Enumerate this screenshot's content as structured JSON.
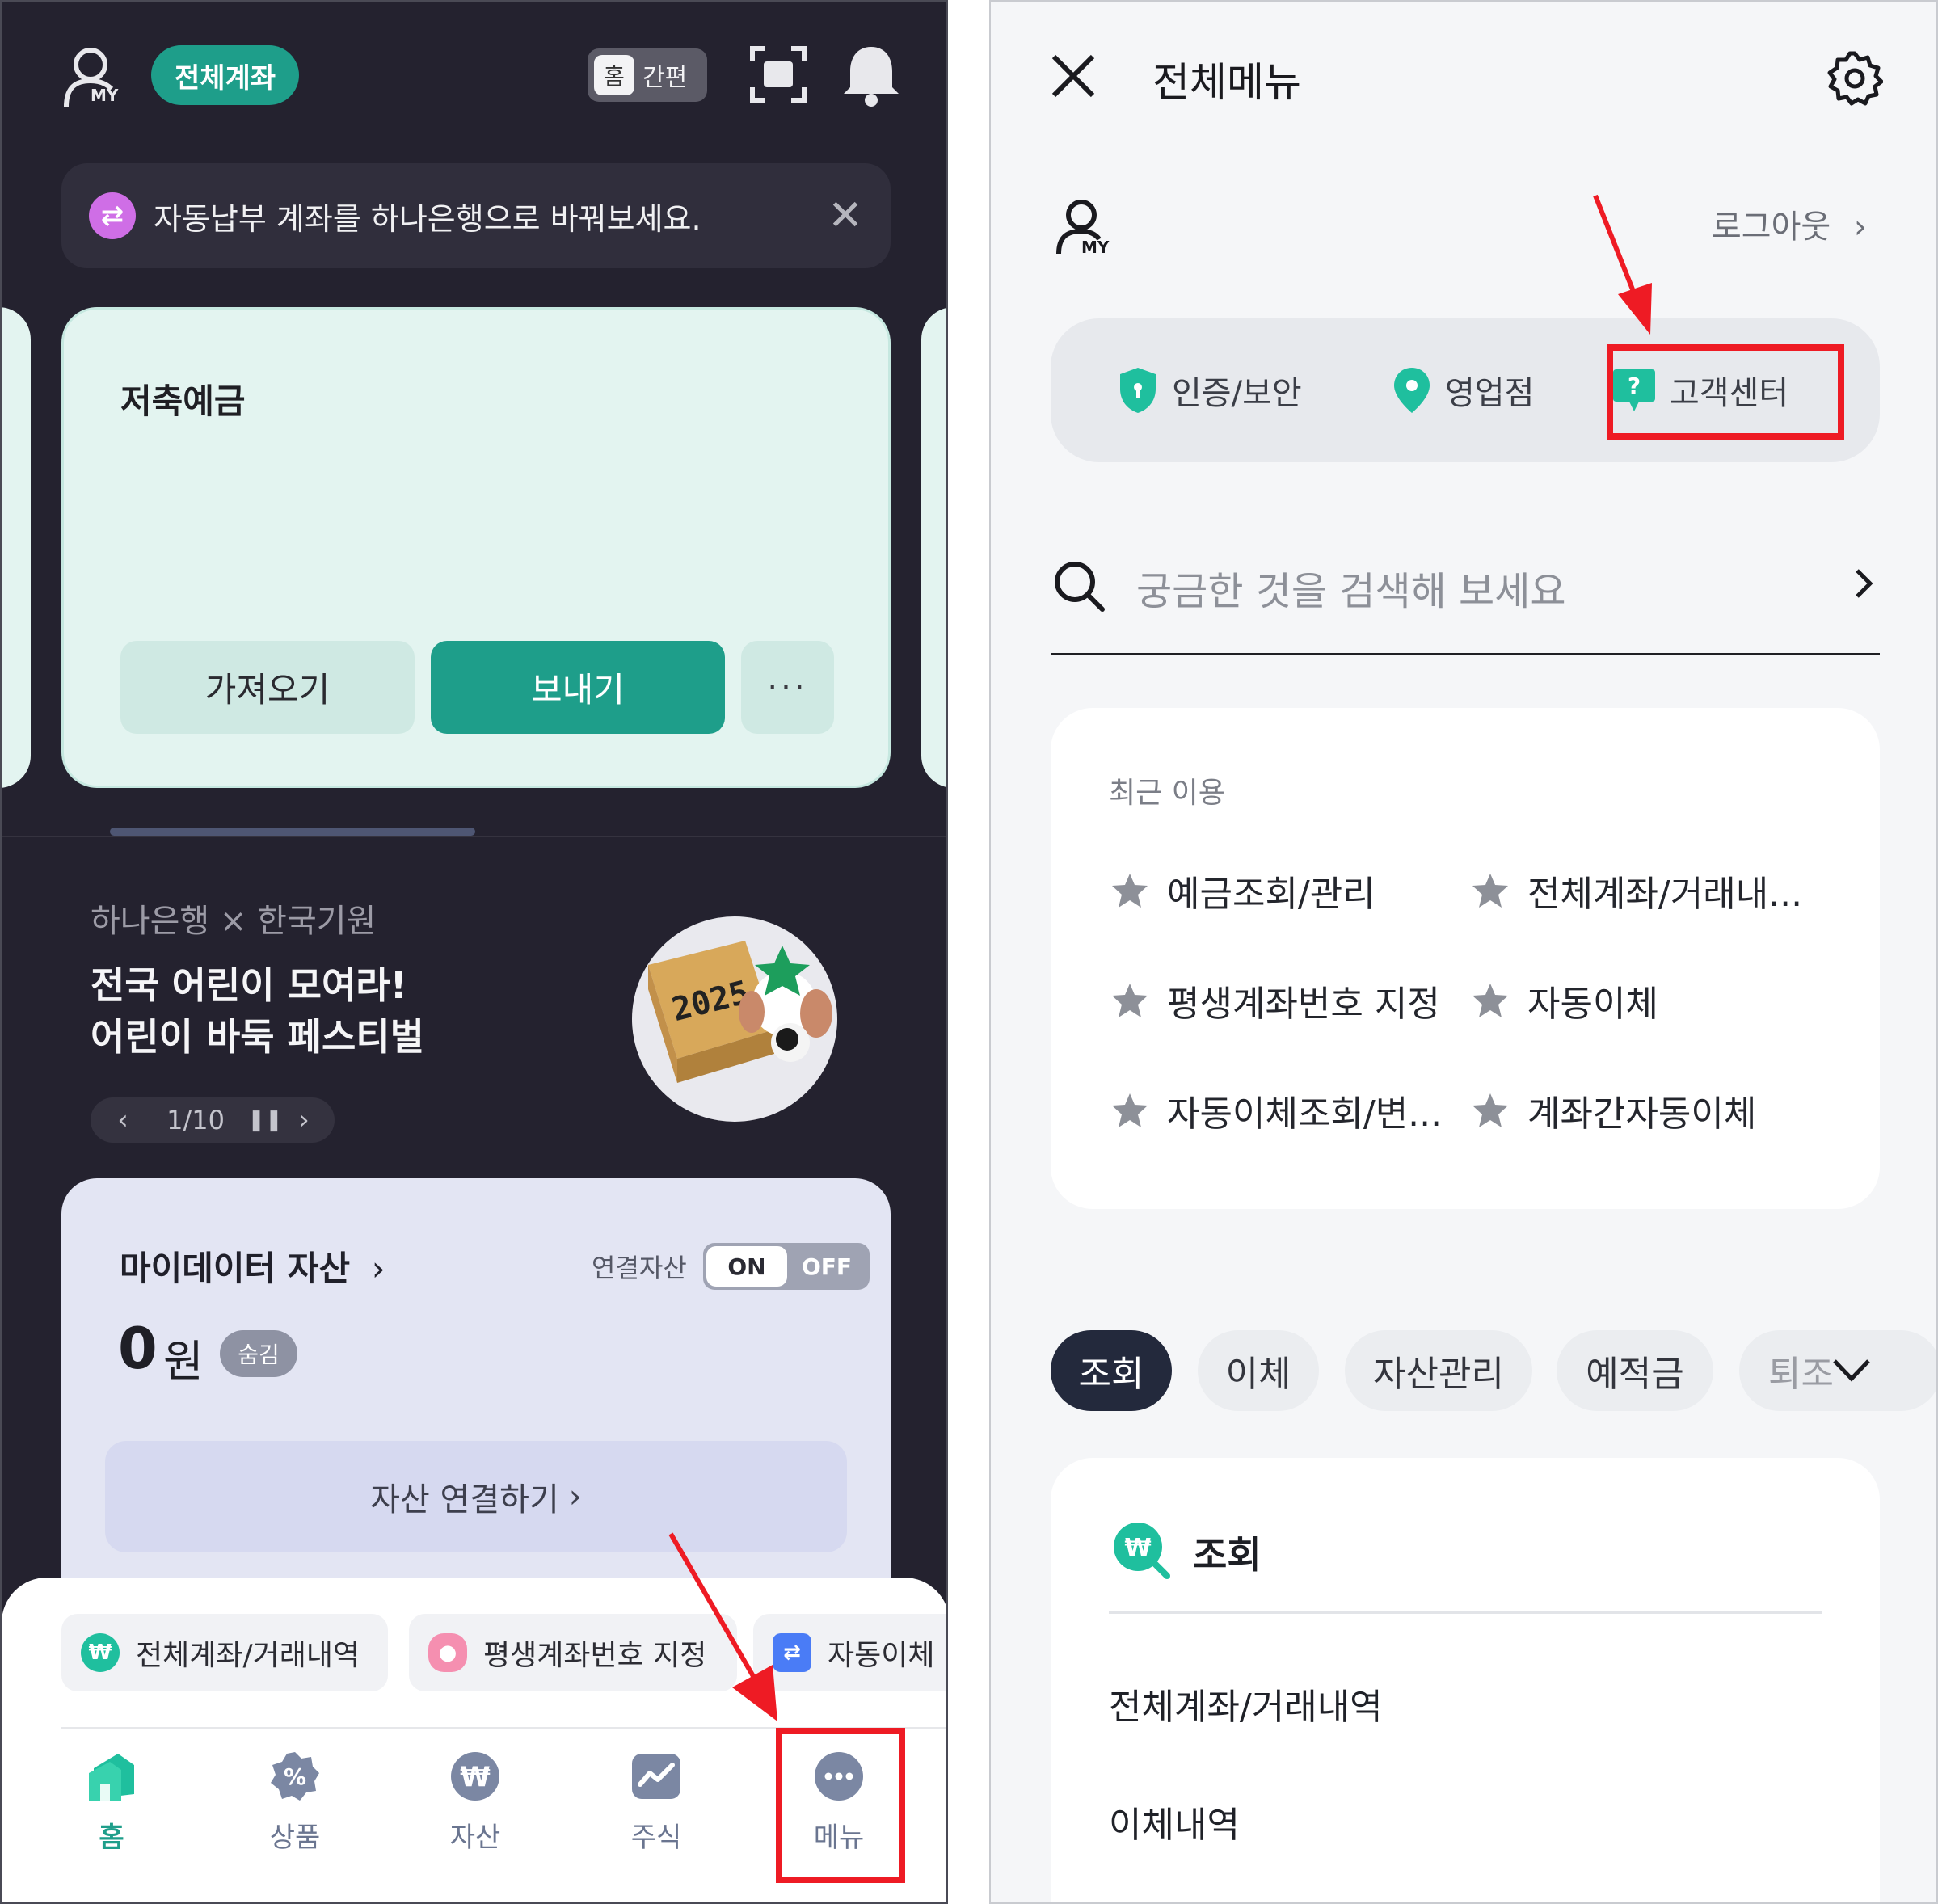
{
  "left": {
    "top_bar": {
      "my_label": "MY",
      "all_accounts_label": "전체계좌",
      "home_label": "홈",
      "simple_label": "간편"
    },
    "notice": {
      "text": "자동납부 계좌를 하나은행으로 바꿔보세요.",
      "icon": "swap-icon"
    },
    "savings_card": {
      "title": "저축예금",
      "get_button": "가져오기",
      "send_button": "보내기",
      "more_button": "···"
    },
    "promo": {
      "subtitle": "하나은행 × 한국기원",
      "title_line1": "전국 어린이 모여라!",
      "title_line2": "어린이 바둑 페스티벌",
      "pager": "1/10",
      "art_text": "2025"
    },
    "mydata": {
      "title": "마이데이터 자산",
      "linked_label": "연결자산",
      "toggle_on": "ON",
      "toggle_off": "OFF",
      "amount": "0",
      "unit": "원",
      "hide_label": "숨김",
      "connect_button": "자산 연결하기"
    },
    "quick_chips": [
      {
        "label": "전체계좌/거래내역",
        "icon": "won-search-icon",
        "color": "#1fbf9e"
      },
      {
        "label": "평생계좌번호 지정",
        "icon": "piggy-bank-icon",
        "color": "#f58fb0"
      },
      {
        "label": "자동이체",
        "icon": "transfer-icon",
        "color": "#4a7cf6"
      }
    ],
    "tabs": [
      {
        "label": "홈",
        "icon": "home-icon"
      },
      {
        "label": "상품",
        "icon": "product-percent-icon"
      },
      {
        "label": "자산",
        "icon": "won-icon"
      },
      {
        "label": "주식",
        "icon": "stock-chart-icon"
      },
      {
        "label": "메뉴",
        "icon": "more-dots-icon"
      }
    ],
    "colors": {
      "accent": "#1e9e8a",
      "background": "#24222f",
      "highlight": "#ee1b24"
    }
  },
  "right": {
    "title": "전체메뉴",
    "my_label": "MY",
    "logout": "로그아웃",
    "quick": [
      {
        "label": "인증/보안",
        "icon": "shield-icon"
      },
      {
        "label": "영업점",
        "icon": "location-pin-icon"
      },
      {
        "label": "고객센터",
        "icon": "help-chat-icon"
      }
    ],
    "search_placeholder": "궁금한 것을 검색해 보세요",
    "recent": {
      "title": "최근 이용",
      "items": [
        "예금조회/관리",
        "전체계좌/거래내...",
        "평생계좌번호 지정",
        "자동이체",
        "자동이체조회/변...",
        "계좌간자동이체"
      ]
    },
    "categories": [
      "조회",
      "이체",
      "자산관리",
      "예적금",
      "퇴조"
    ],
    "section": {
      "title": "조회",
      "items": [
        "전체계좌/거래내역",
        "이체내역"
      ]
    },
    "colors": {
      "background": "#f5f6f8",
      "active_category": "#23293c",
      "highlight": "#ee1b24"
    }
  }
}
